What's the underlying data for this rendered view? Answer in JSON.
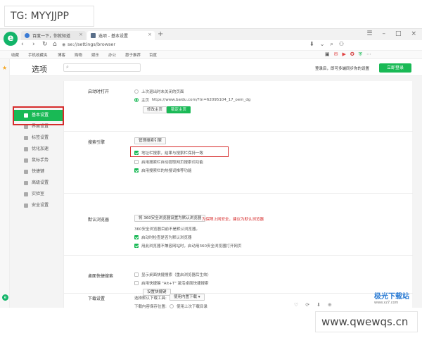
{
  "overlay_tag": "TG: MYYJJPP",
  "bottom_watermark": "www.qwewqs.cn",
  "site_watermark": {
    "title": "极光下载站",
    "subtitle": "www.xz7.com"
  },
  "browser": {
    "logo": "e",
    "tabs": [
      {
        "label": "百度一下，你就知道",
        "active": false
      },
      {
        "label": "选项 - 基本设置",
        "active": true
      }
    ],
    "new_tab": "+",
    "url": "se://settings/browser",
    "bookmarks": [
      "收藏",
      "手机收藏夹",
      "博客",
      "购物",
      "娱乐",
      "办公",
      "惠子推荐",
      "百度"
    ]
  },
  "settings": {
    "title": "选项",
    "search_placeholder": "",
    "login_prompt": "登录后，即可多端同步你的设置",
    "login_button": "立即登录",
    "nav": [
      {
        "label": "基本设置",
        "active": true
      },
      {
        "label": "界面设置",
        "active": false
      },
      {
        "label": "标签设置",
        "active": false
      },
      {
        "label": "优化加速",
        "active": false
      },
      {
        "label": "鼠标手势",
        "active": false
      },
      {
        "label": "快捷键",
        "active": false
      },
      {
        "label": "高级设置",
        "active": false
      },
      {
        "label": "实验室",
        "active": false
      },
      {
        "label": "安全设置",
        "active": false
      }
    ],
    "startup": {
      "label": "启动时打开",
      "option_restore": "上次退出时未关闭的页面",
      "option_home": "主页",
      "home_url": "https://www.baidu.com/?tn=62095104_17_oem_dg",
      "btn_modify": "修改主页",
      "btn_lock": "锁定主页"
    },
    "search_engine": {
      "label": "搜索引擎",
      "btn_manage": "管理搜索引擎",
      "opt_sync": "地址栏搜索，结果与搜索栏保持一致",
      "opt_prefetch": "启用搜索栏自动提取网页搜索词功能",
      "opt_hot": "启用搜索栏的热搜词推荐功能"
    },
    "default_browser": {
      "label": "默认浏览器",
      "btn_set": "将 360安全浏览器设置为默认浏览器",
      "warn": "为保障上网安全，建议为默认浏览器",
      "status": "360安全浏览器目前不是默认浏览器。",
      "opt_check": "启动时检查是否为默认浏览器",
      "opt_open": "用此浏览器不兼容网站时，启动用360安全浏览器打开网页"
    },
    "desktop_search": {
      "label": "桌面快捷搜索",
      "opt_show": "显示桌面快捷搜索（重启浏览器后生效）",
      "opt_hotkey": "启用快捷键 \"Alt+T\" 激活桌面快捷搜索",
      "btn_set": "设置快捷键"
    },
    "download": {
      "label": "下载设置",
      "tool_label": "选择默认下载工具:",
      "tool_value": "使用内置下载",
      "location_label": "下载内容保存位置:",
      "location_value": "使用上次下载目录"
    }
  }
}
